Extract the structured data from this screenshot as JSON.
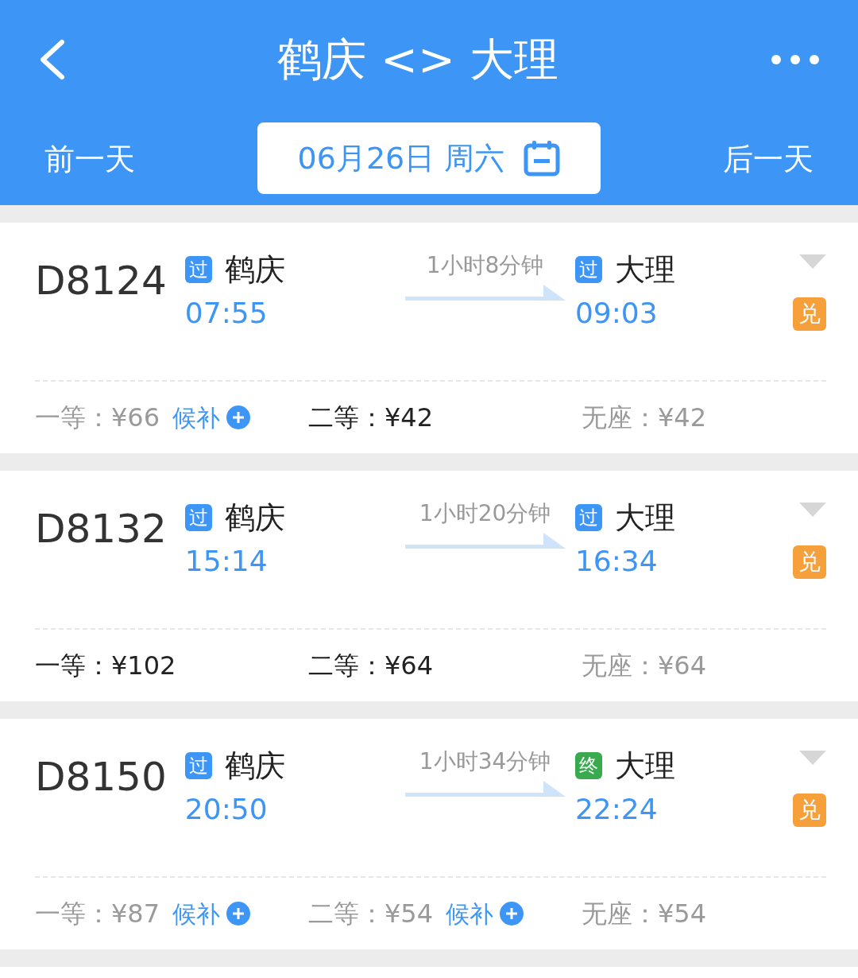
{
  "header": {
    "title": "鹤庆 <> 大理",
    "prev_day": "前一天",
    "date": "06月26日 周六",
    "next_day": "后一天"
  },
  "trains": [
    {
      "number": "D8124",
      "from": {
        "badge": "过",
        "color": "#3d95f5",
        "station": "鹤庆",
        "time": "07:55"
      },
      "duration": "1小时8分钟",
      "to": {
        "badge": "过",
        "color": "#3d95f5",
        "station": "大理",
        "time": "09:03"
      },
      "exchange": "兑",
      "seats": [
        {
          "text": "一等：¥66",
          "available": false,
          "waitlist": "候补"
        },
        {
          "text": "二等：¥42",
          "available": true
        },
        {
          "text": "无座：¥42",
          "available": false
        }
      ]
    },
    {
      "number": "D8132",
      "from": {
        "badge": "过",
        "color": "#3d95f5",
        "station": "鹤庆",
        "time": "15:14"
      },
      "duration": "1小时20分钟",
      "to": {
        "badge": "过",
        "color": "#3d95f5",
        "station": "大理",
        "time": "16:34"
      },
      "exchange": "兑",
      "seats": [
        {
          "text": "一等：¥102",
          "available": true
        },
        {
          "text": "二等：¥64",
          "available": true
        },
        {
          "text": "无座：¥64",
          "available": false
        }
      ]
    },
    {
      "number": "D8150",
      "from": {
        "badge": "过",
        "color": "#3d95f5",
        "station": "鹤庆",
        "time": "20:50"
      },
      "duration": "1小时34分钟",
      "to": {
        "badge": "终",
        "color": "#3aaa4e",
        "station": "大理",
        "time": "22:24"
      },
      "exchange": "兑",
      "seats": [
        {
          "text": "一等：¥87",
          "available": false,
          "waitlist": "候补"
        },
        {
          "text": "二等：¥54",
          "available": false,
          "waitlist": "候补"
        },
        {
          "text": "无座：¥54",
          "available": false
        }
      ]
    }
  ]
}
